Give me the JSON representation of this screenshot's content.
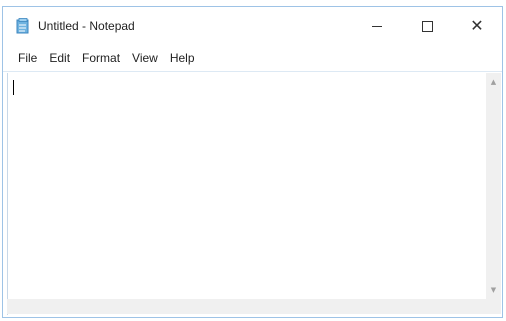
{
  "window": {
    "title": "Untitled - Notepad",
    "app_icon": "notepad-icon",
    "minimize_icon": "minimize-icon",
    "maximize_icon": "maximize-icon",
    "close_icon": "close-icon"
  },
  "menu": {
    "items": [
      {
        "label": "File"
      },
      {
        "label": "Edit"
      },
      {
        "label": "Format"
      },
      {
        "label": "View"
      },
      {
        "label": "Help"
      }
    ]
  },
  "editor": {
    "text": ""
  },
  "colors": {
    "window_border": "#9ec3e6",
    "menu_divider": "#dde9f4",
    "scrollbar_track": "#f0f0f0"
  }
}
